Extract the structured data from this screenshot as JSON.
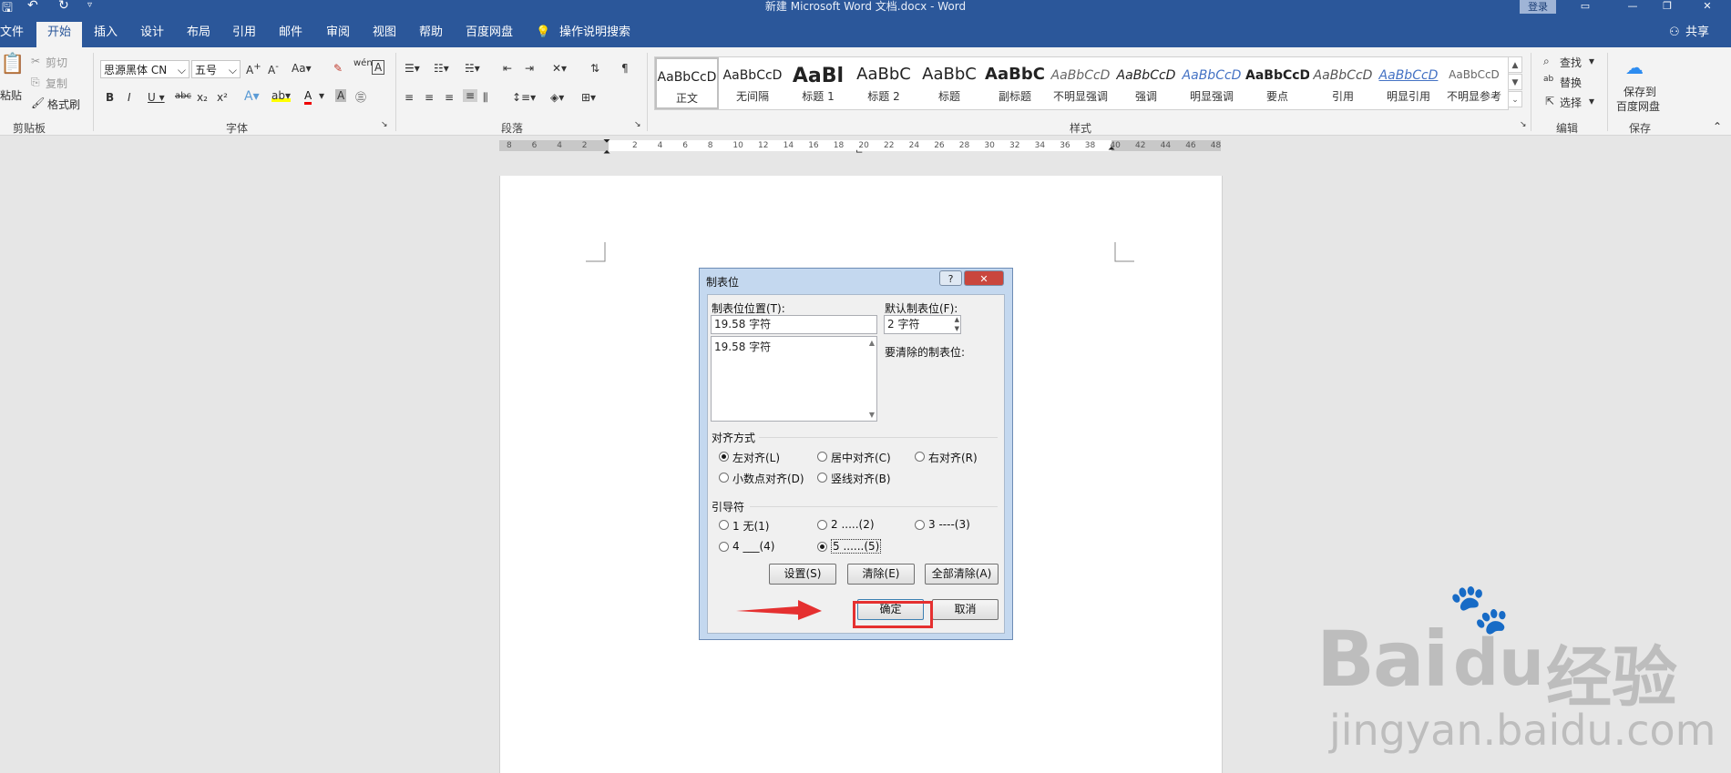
{
  "window": {
    "title": "新建 Microsoft Word 文档.docx  -  Word",
    "login": "登录",
    "share": "共享"
  },
  "tabs": [
    "文件",
    "开始",
    "插入",
    "设计",
    "布局",
    "引用",
    "邮件",
    "审阅",
    "视图",
    "帮助",
    "百度网盘",
    "操作说明搜索"
  ],
  "ribbon": {
    "clipboard": {
      "paste": "粘贴",
      "cut": "剪切",
      "copy": "复制",
      "format_painter": "格式刷",
      "label": "剪贴板"
    },
    "font": {
      "family": "思源黑体 CN",
      "size": "五号",
      "label": "字体"
    },
    "paragraph": {
      "label": "段落"
    },
    "styles": {
      "label": "样式",
      "items": [
        {
          "preview": "AaBbCcD",
          "name": "正文"
        },
        {
          "preview": "AaBbCcD",
          "name": "无间隔"
        },
        {
          "preview": "AaBl",
          "name": "标题 1"
        },
        {
          "preview": "AaBbC",
          "name": "标题 2"
        },
        {
          "preview": "AaBbC",
          "name": "标题"
        },
        {
          "preview": "AaBbC",
          "name": "副标题"
        },
        {
          "preview": "AaBbCcD",
          "name": "不明显强调"
        },
        {
          "preview": "AaBbCcD",
          "name": "强调"
        },
        {
          "preview": "AaBbCcD",
          "name": "明显强调"
        },
        {
          "preview": "AaBbCcD",
          "name": "要点"
        },
        {
          "preview": "AaBbCcD",
          "name": "引用"
        },
        {
          "preview": "AaBbCcD",
          "name": "明显引用"
        },
        {
          "preview": "AaBbCcD",
          "name": "不明显参考"
        }
      ]
    },
    "editing": {
      "find": "查找",
      "replace": "替换",
      "select": "选择",
      "label": "编辑"
    },
    "save": {
      "line1": "保存到",
      "line2": "百度网盘",
      "label": "保存"
    }
  },
  "ruler": {
    "ticks": [
      "8",
      "6",
      "4",
      "2",
      "",
      "2",
      "4",
      "6",
      "8",
      "10",
      "12",
      "14",
      "16",
      "18",
      "20",
      "22",
      "24",
      "26",
      "28",
      "30",
      "32",
      "34",
      "36",
      "38",
      "40",
      "42",
      "44",
      "46",
      "48"
    ]
  },
  "dialog": {
    "title": "制表位",
    "help": "?",
    "close": "✕",
    "tab_pos_label": "制表位位置(T):",
    "tab_pos_value": "19.58 字符",
    "tab_list": [
      "19.58 字符"
    ],
    "default_label": "默认制表位(F):",
    "default_value": "2 字符",
    "clear_label": "要清除的制表位:",
    "alignment_label": "对齐方式",
    "alignment": [
      "左对齐(L)",
      "居中对齐(C)",
      "右对齐(R)",
      "小数点对齐(D)",
      "竖线对齐(B)"
    ],
    "alignment_selected": "左对齐(L)",
    "leader_label": "引导符",
    "leaders": [
      "1 无(1)",
      "2 .....(2)",
      "3 ----(3)",
      "4 ___(4)",
      "5 ......(5)"
    ],
    "leader_selected": "5 ......(5)",
    "btn_set": "设置(S)",
    "btn_clear": "清除(E)",
    "btn_clear_all": "全部清除(A)",
    "btn_ok": "确定",
    "btn_cancel": "取消"
  },
  "watermark": {
    "brand": "Bai",
    "brand2": "du",
    "cn": "经验",
    "url": "jingyan.baidu.com"
  },
  "colors": {
    "word_blue": "#2b579a",
    "highlight_red": "#e53030"
  }
}
